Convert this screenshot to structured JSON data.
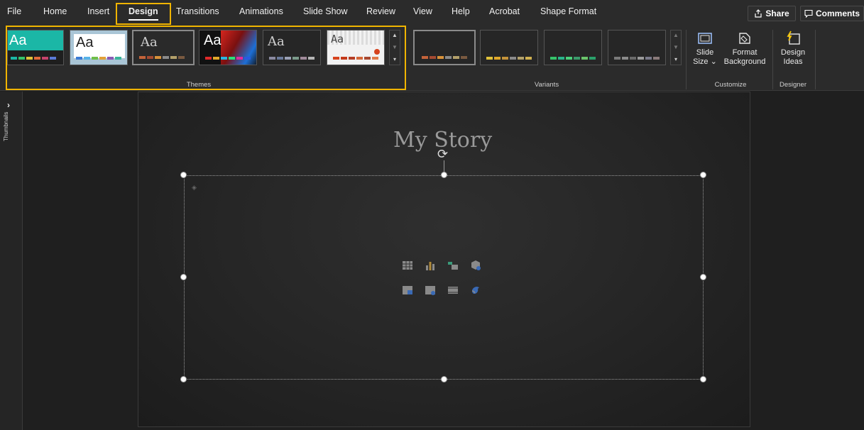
{
  "menu": {
    "tabs": [
      "File",
      "Home",
      "Insert",
      "Design",
      "Transitions",
      "Animations",
      "Slide Show",
      "Review",
      "View",
      "Help",
      "Acrobat",
      "Shape Format"
    ],
    "active_tab": "Design",
    "share_label": "Share",
    "comments_label": "Comments"
  },
  "ribbon": {
    "themes": {
      "label": "Themes",
      "items": [
        {
          "text": "Aa",
          "bg": "#1bb7a6",
          "fg": "#ffffff"
        },
        {
          "text": "Aa",
          "bg": "#a9c5d6",
          "fg": "#222222"
        },
        {
          "text": "Aa",
          "bg": "#2a2a2a",
          "fg": "#d0d0d0"
        },
        {
          "text": "Aa",
          "bg": "#111111",
          "fg": "#ffffff"
        },
        {
          "text": "Aa",
          "bg": "#262626",
          "fg": "#d0d0d0"
        },
        {
          "text": "Aa",
          "bg": "#f2f2f2",
          "fg": "#444444"
        }
      ]
    },
    "variants": {
      "label": "Variants"
    },
    "customize": {
      "label": "Customize",
      "slide_size_line1": "Slide",
      "slide_size_line2": "Size ⌄",
      "format_bg_line1": "Format",
      "format_bg_line2": "Background"
    },
    "designer": {
      "label": "Designer",
      "design_ideas_line1": "Design",
      "design_ideas_line2": "Ideas"
    }
  },
  "left_pane": {
    "chevron": "›",
    "label": "Thumbnails"
  },
  "slide": {
    "title": "My Story"
  },
  "colors": {
    "accent_highlight": "#f0b400",
    "ribbon_bg": "#2b2b2b"
  }
}
